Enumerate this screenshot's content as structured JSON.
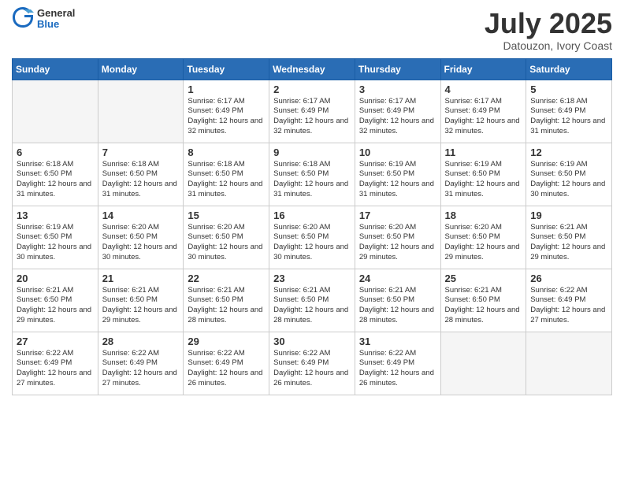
{
  "header": {
    "logo_general": "General",
    "logo_blue": "Blue",
    "month_title": "July 2025",
    "location": "Datouzon, Ivory Coast"
  },
  "calendar": {
    "days_of_week": [
      "Sunday",
      "Monday",
      "Tuesday",
      "Wednesday",
      "Thursday",
      "Friday",
      "Saturday"
    ],
    "weeks": [
      [
        {
          "day": "",
          "info": ""
        },
        {
          "day": "",
          "info": ""
        },
        {
          "day": "1",
          "info": "Sunrise: 6:17 AM\nSunset: 6:49 PM\nDaylight: 12 hours and 32 minutes."
        },
        {
          "day": "2",
          "info": "Sunrise: 6:17 AM\nSunset: 6:49 PM\nDaylight: 12 hours and 32 minutes."
        },
        {
          "day": "3",
          "info": "Sunrise: 6:17 AM\nSunset: 6:49 PM\nDaylight: 12 hours and 32 minutes."
        },
        {
          "day": "4",
          "info": "Sunrise: 6:17 AM\nSunset: 6:49 PM\nDaylight: 12 hours and 32 minutes."
        },
        {
          "day": "5",
          "info": "Sunrise: 6:18 AM\nSunset: 6:49 PM\nDaylight: 12 hours and 31 minutes."
        }
      ],
      [
        {
          "day": "6",
          "info": "Sunrise: 6:18 AM\nSunset: 6:50 PM\nDaylight: 12 hours and 31 minutes."
        },
        {
          "day": "7",
          "info": "Sunrise: 6:18 AM\nSunset: 6:50 PM\nDaylight: 12 hours and 31 minutes."
        },
        {
          "day": "8",
          "info": "Sunrise: 6:18 AM\nSunset: 6:50 PM\nDaylight: 12 hours and 31 minutes."
        },
        {
          "day": "9",
          "info": "Sunrise: 6:18 AM\nSunset: 6:50 PM\nDaylight: 12 hours and 31 minutes."
        },
        {
          "day": "10",
          "info": "Sunrise: 6:19 AM\nSunset: 6:50 PM\nDaylight: 12 hours and 31 minutes."
        },
        {
          "day": "11",
          "info": "Sunrise: 6:19 AM\nSunset: 6:50 PM\nDaylight: 12 hours and 31 minutes."
        },
        {
          "day": "12",
          "info": "Sunrise: 6:19 AM\nSunset: 6:50 PM\nDaylight: 12 hours and 30 minutes."
        }
      ],
      [
        {
          "day": "13",
          "info": "Sunrise: 6:19 AM\nSunset: 6:50 PM\nDaylight: 12 hours and 30 minutes."
        },
        {
          "day": "14",
          "info": "Sunrise: 6:20 AM\nSunset: 6:50 PM\nDaylight: 12 hours and 30 minutes."
        },
        {
          "day": "15",
          "info": "Sunrise: 6:20 AM\nSunset: 6:50 PM\nDaylight: 12 hours and 30 minutes."
        },
        {
          "day": "16",
          "info": "Sunrise: 6:20 AM\nSunset: 6:50 PM\nDaylight: 12 hours and 30 minutes."
        },
        {
          "day": "17",
          "info": "Sunrise: 6:20 AM\nSunset: 6:50 PM\nDaylight: 12 hours and 29 minutes."
        },
        {
          "day": "18",
          "info": "Sunrise: 6:20 AM\nSunset: 6:50 PM\nDaylight: 12 hours and 29 minutes."
        },
        {
          "day": "19",
          "info": "Sunrise: 6:21 AM\nSunset: 6:50 PM\nDaylight: 12 hours and 29 minutes."
        }
      ],
      [
        {
          "day": "20",
          "info": "Sunrise: 6:21 AM\nSunset: 6:50 PM\nDaylight: 12 hours and 29 minutes."
        },
        {
          "day": "21",
          "info": "Sunrise: 6:21 AM\nSunset: 6:50 PM\nDaylight: 12 hours and 29 minutes."
        },
        {
          "day": "22",
          "info": "Sunrise: 6:21 AM\nSunset: 6:50 PM\nDaylight: 12 hours and 28 minutes."
        },
        {
          "day": "23",
          "info": "Sunrise: 6:21 AM\nSunset: 6:50 PM\nDaylight: 12 hours and 28 minutes."
        },
        {
          "day": "24",
          "info": "Sunrise: 6:21 AM\nSunset: 6:50 PM\nDaylight: 12 hours and 28 minutes."
        },
        {
          "day": "25",
          "info": "Sunrise: 6:21 AM\nSunset: 6:50 PM\nDaylight: 12 hours and 28 minutes."
        },
        {
          "day": "26",
          "info": "Sunrise: 6:22 AM\nSunset: 6:49 PM\nDaylight: 12 hours and 27 minutes."
        }
      ],
      [
        {
          "day": "27",
          "info": "Sunrise: 6:22 AM\nSunset: 6:49 PM\nDaylight: 12 hours and 27 minutes."
        },
        {
          "day": "28",
          "info": "Sunrise: 6:22 AM\nSunset: 6:49 PM\nDaylight: 12 hours and 27 minutes."
        },
        {
          "day": "29",
          "info": "Sunrise: 6:22 AM\nSunset: 6:49 PM\nDaylight: 12 hours and 26 minutes."
        },
        {
          "day": "30",
          "info": "Sunrise: 6:22 AM\nSunset: 6:49 PM\nDaylight: 12 hours and 26 minutes."
        },
        {
          "day": "31",
          "info": "Sunrise: 6:22 AM\nSunset: 6:49 PM\nDaylight: 12 hours and 26 minutes."
        },
        {
          "day": "",
          "info": ""
        },
        {
          "day": "",
          "info": ""
        }
      ]
    ]
  }
}
